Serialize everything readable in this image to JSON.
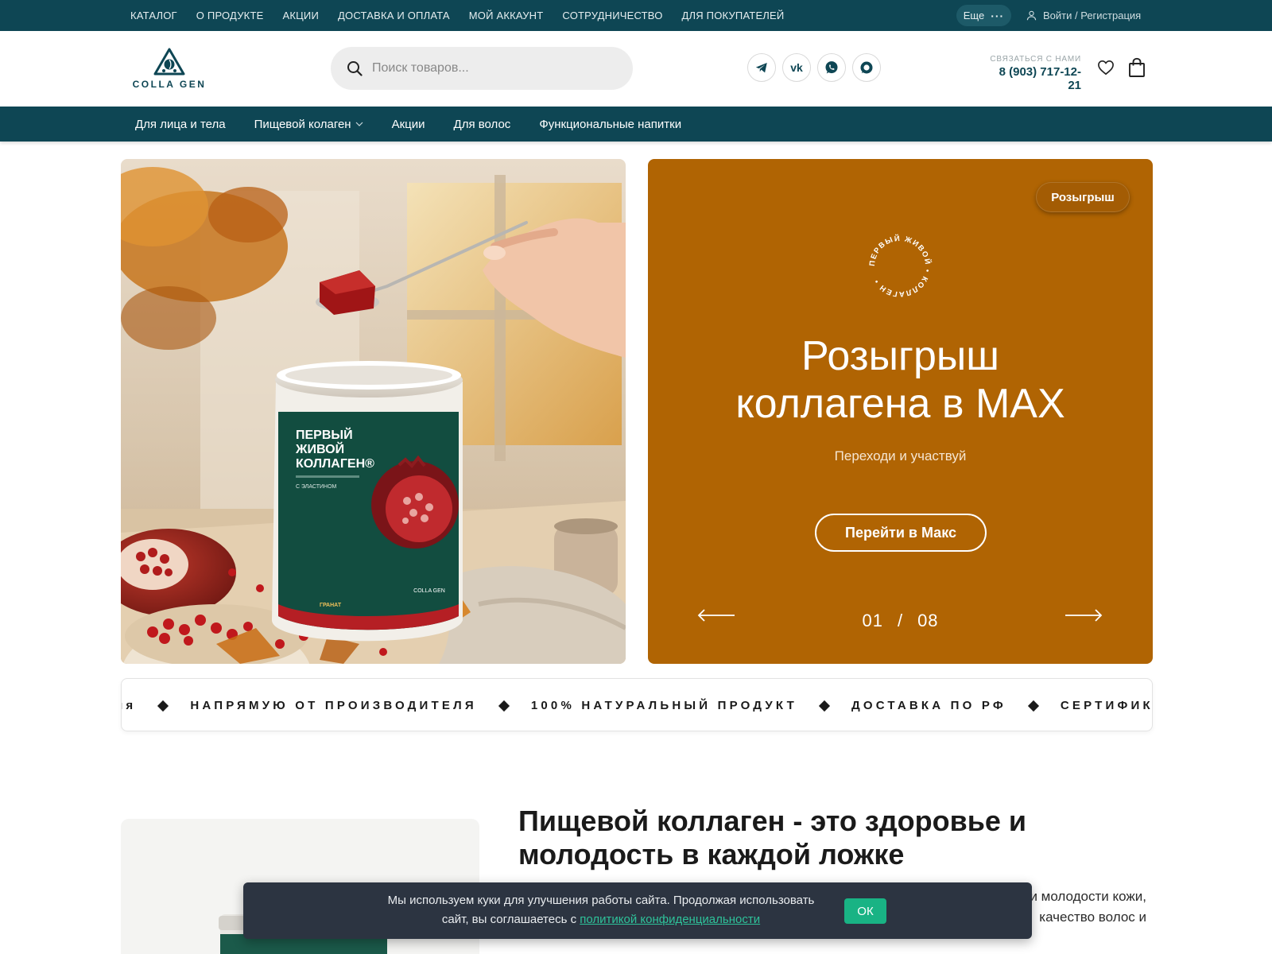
{
  "topnav": {
    "items": [
      "КАТАЛОГ",
      "О ПРОДУКТЕ",
      "АКЦИИ",
      "ДОСТАВКА И ОПЛАТА",
      "МОЙ АККАУНТ",
      "СОТРУДНИЧЕСТВО",
      "ДЛЯ ПОКУПАТЕЛЕЙ"
    ],
    "more_label": "Еще",
    "login_label": "Войти / Регистрация"
  },
  "header": {
    "logo_text": "COLLA GEN",
    "search_placeholder": "Поиск товаров...",
    "socials": [
      "telegram-icon",
      "vk-icon",
      "whatsapp-icon",
      "max-messenger-icon"
    ],
    "contact_label": "Связаться с нами",
    "phone": "8 (903) 717-12-21",
    "accent_color": "#0e4654"
  },
  "catnav": {
    "items": [
      "Для лица и тела",
      "Пищевой колаген",
      "Акции",
      "Для волос",
      "Функциональные напитки"
    ]
  },
  "hero": {
    "product": {
      "jar_line1": "ПЕРВЫЙ",
      "jar_line2": "ЖИВОЙ",
      "jar_line3": "КОЛЛАГЕН®",
      "jar_line4": "С ЭЛАСТИНОМ",
      "jar_brand": "COLLA GEN",
      "jar_flavor": "ГРАНАТ"
    },
    "promo": {
      "badge": "Розыгрыш",
      "seal_text": "ПЕРВЫЙ ЖИВОЙ • КОЛЛАГЕН •",
      "title_line1": "Розыгрыш",
      "title_line2": "коллагена в MAX",
      "subtitle": "Переходи и участвуй",
      "button": "Перейти в Макс",
      "current": "01",
      "separator": "/",
      "total": "08",
      "bg_color": "#b06403"
    }
  },
  "marquee": {
    "items": [
      "ия",
      "НАПРЯМУЮ ОТ ПРОИЗВОДИТЕЛЯ",
      "100% НАТУРАЛЬНЫЙ ПРОДУКТ",
      "ДОСТАВКА ПО РФ",
      "СЕРТИФИКАТЫ"
    ]
  },
  "about": {
    "title": "Пищевой коллаген - это здоровье и молодость в каждой ложке",
    "text": "составом, укрепление мышечного каркаса, поддержание и сохранение красоты и молодости кожи, качество волос и"
  },
  "cookie": {
    "text": "Мы используем куки для улучшения работы сайта. Продолжая использовать сайт, вы соглашаетесь с",
    "link": "политикой конфиденциальности",
    "ok": "ОК"
  }
}
